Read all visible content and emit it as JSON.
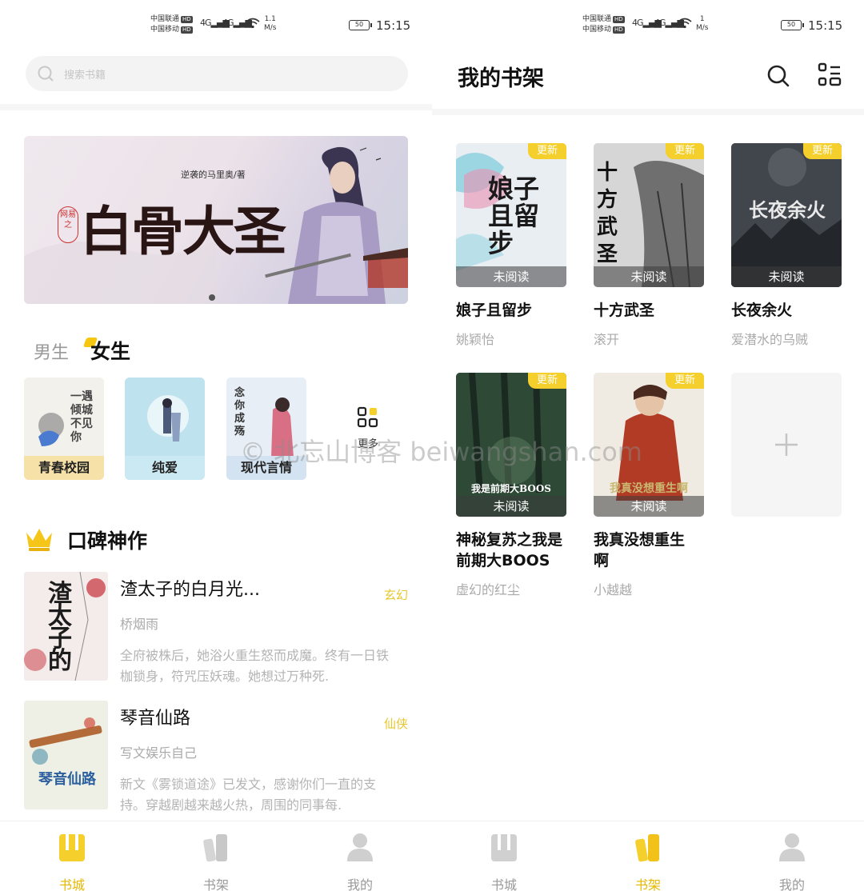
{
  "watermark": "© 北忘山博客 beiwangshan.com",
  "status_left": {
    "carrier1": "中国联通",
    "carrier2": "中国移动",
    "hd": "HD",
    "net1": "4G",
    "net2": "4G",
    "speed": "1.1",
    "speed_unit": "M/s",
    "battery": "50",
    "time": "15:15"
  },
  "status_right": {
    "carrier1": "中国联通",
    "carrier2": "中国移动",
    "hd": "HD",
    "net1": "4G",
    "net2": "4G",
    "speed": "1",
    "speed_unit": "M/s",
    "battery": "50",
    "time": "15:15"
  },
  "store": {
    "search_placeholder": "搜索书籍",
    "banner": {
      "title": "白骨大圣",
      "author_credit": "逆袭的马里奥/著",
      "seal": "网易之"
    },
    "tabs": {
      "male": "男生",
      "female": "女生"
    },
    "categories": [
      {
        "label": "青春校园",
        "bg": "#f5dfb0",
        "cover_text": "一遇倾城不见你"
      },
      {
        "label": "纯爱",
        "bg": "#bfe1ee",
        "cover_text": ""
      },
      {
        "label": "现代言情",
        "bg": "#d9e6f2",
        "cover_text": "念你成殇"
      }
    ],
    "more_label": "更多",
    "section_title": "口碑神作",
    "books": [
      {
        "title": "渣太子的白月光...",
        "author": "桥烟雨",
        "genre": "玄幻",
        "desc": "全府被株后，她浴火重生怒而成魔。终有一日铁枷锁身，符咒压妖魂。她想过万种死.",
        "cover_text": "渣太子的"
      },
      {
        "title": "琴音仙路",
        "author": "写文娱乐自己",
        "genre": "仙侠",
        "desc": "新文《雾锁道途》已发文，感谢你们一直的支持。穿越剧越来越火热，周围的同事每.",
        "cover_text": "琴音仙路"
      }
    ],
    "nav": [
      {
        "label": "书城",
        "active": true
      },
      {
        "label": "书架",
        "active": false
      },
      {
        "label": "我的",
        "active": false
      }
    ]
  },
  "shelf": {
    "title": "我的书架",
    "new_badge": "更新",
    "unread_label": "未阅读",
    "books": [
      {
        "title": "娘子且留步",
        "author": "姚颖怡",
        "cover_text": "娘子且留步",
        "new": true
      },
      {
        "title": "十方武圣",
        "author": "滚开",
        "cover_text": "十方武圣",
        "new": true
      },
      {
        "title": "长夜余火",
        "author": "爱潜水的乌贼",
        "cover_text": "长夜余火",
        "new": true
      },
      {
        "title": "神秘复苏之我是前期大BOOS",
        "author": "虚幻的红尘",
        "cover_text": "我是前期大BOOS",
        "new": true
      },
      {
        "title": "我真没想重生啊",
        "author": "小越越",
        "cover_text": "我真没想重生啊",
        "new": true
      }
    ],
    "nav": [
      {
        "label": "书城",
        "active": false
      },
      {
        "label": "书架",
        "active": true
      },
      {
        "label": "我的",
        "active": false
      }
    ]
  },
  "colors": {
    "accent": "#f5cf2c",
    "accent_text": "#e6b800",
    "muted": "#aaaaaa"
  }
}
